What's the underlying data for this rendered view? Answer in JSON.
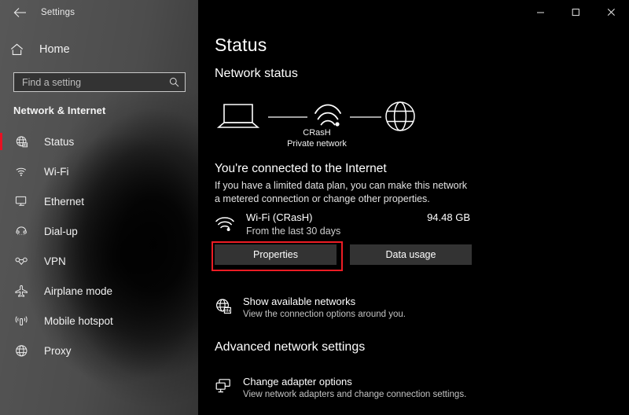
{
  "window": {
    "title": "Settings",
    "back_icon": "back-arrow-icon",
    "controls": {
      "minimize": "–",
      "maximize": "□",
      "close": "✕"
    }
  },
  "sidebar": {
    "home_label": "Home",
    "home_icon": "home-icon",
    "search": {
      "placeholder": "Find a setting",
      "value": "",
      "icon": "search-icon"
    },
    "category": "Network & Internet",
    "accent_color": "#e81123",
    "items": [
      {
        "label": "Status",
        "icon": "network-status-icon",
        "selected": true
      },
      {
        "label": "Wi-Fi",
        "icon": "wifi-icon",
        "selected": false
      },
      {
        "label": "Ethernet",
        "icon": "ethernet-icon",
        "selected": false
      },
      {
        "label": "Dial-up",
        "icon": "dialup-icon",
        "selected": false
      },
      {
        "label": "VPN",
        "icon": "vpn-icon",
        "selected": false
      },
      {
        "label": "Airplane mode",
        "icon": "airplane-icon",
        "selected": false
      },
      {
        "label": "Mobile hotspot",
        "icon": "hotspot-icon",
        "selected": false
      },
      {
        "label": "Proxy",
        "icon": "globe-icon",
        "selected": false
      }
    ]
  },
  "main": {
    "page_title": "Status",
    "network_status_heading": "Network status",
    "diagram": {
      "device_icon": "laptop-icon",
      "link_icon": "wifi-signal-icon",
      "internet_icon": "globe-icon",
      "network_name": "CRasH",
      "network_type": "Private network"
    },
    "connected_title": "You're connected to the Internet",
    "connected_desc": "If you have a limited data plan, you can make this network a metered connection or change other properties.",
    "usage": {
      "icon": "wifi-icon",
      "name": "Wi-Fi (CRasH)",
      "subtitle": "From the last 30 days",
      "amount": "94.48 GB"
    },
    "buttons": {
      "properties": "Properties",
      "data_usage": "Data usage",
      "highlight_color": "#ed1c24"
    },
    "show_networks": {
      "icon": "network-globe-icon",
      "title": "Show available networks",
      "subtitle": "View the connection options around you."
    },
    "advanced_heading": "Advanced network settings",
    "change_adapter": {
      "icon": "adapter-icon",
      "title": "Change adapter options",
      "subtitle": "View network adapters and change connection settings."
    }
  }
}
